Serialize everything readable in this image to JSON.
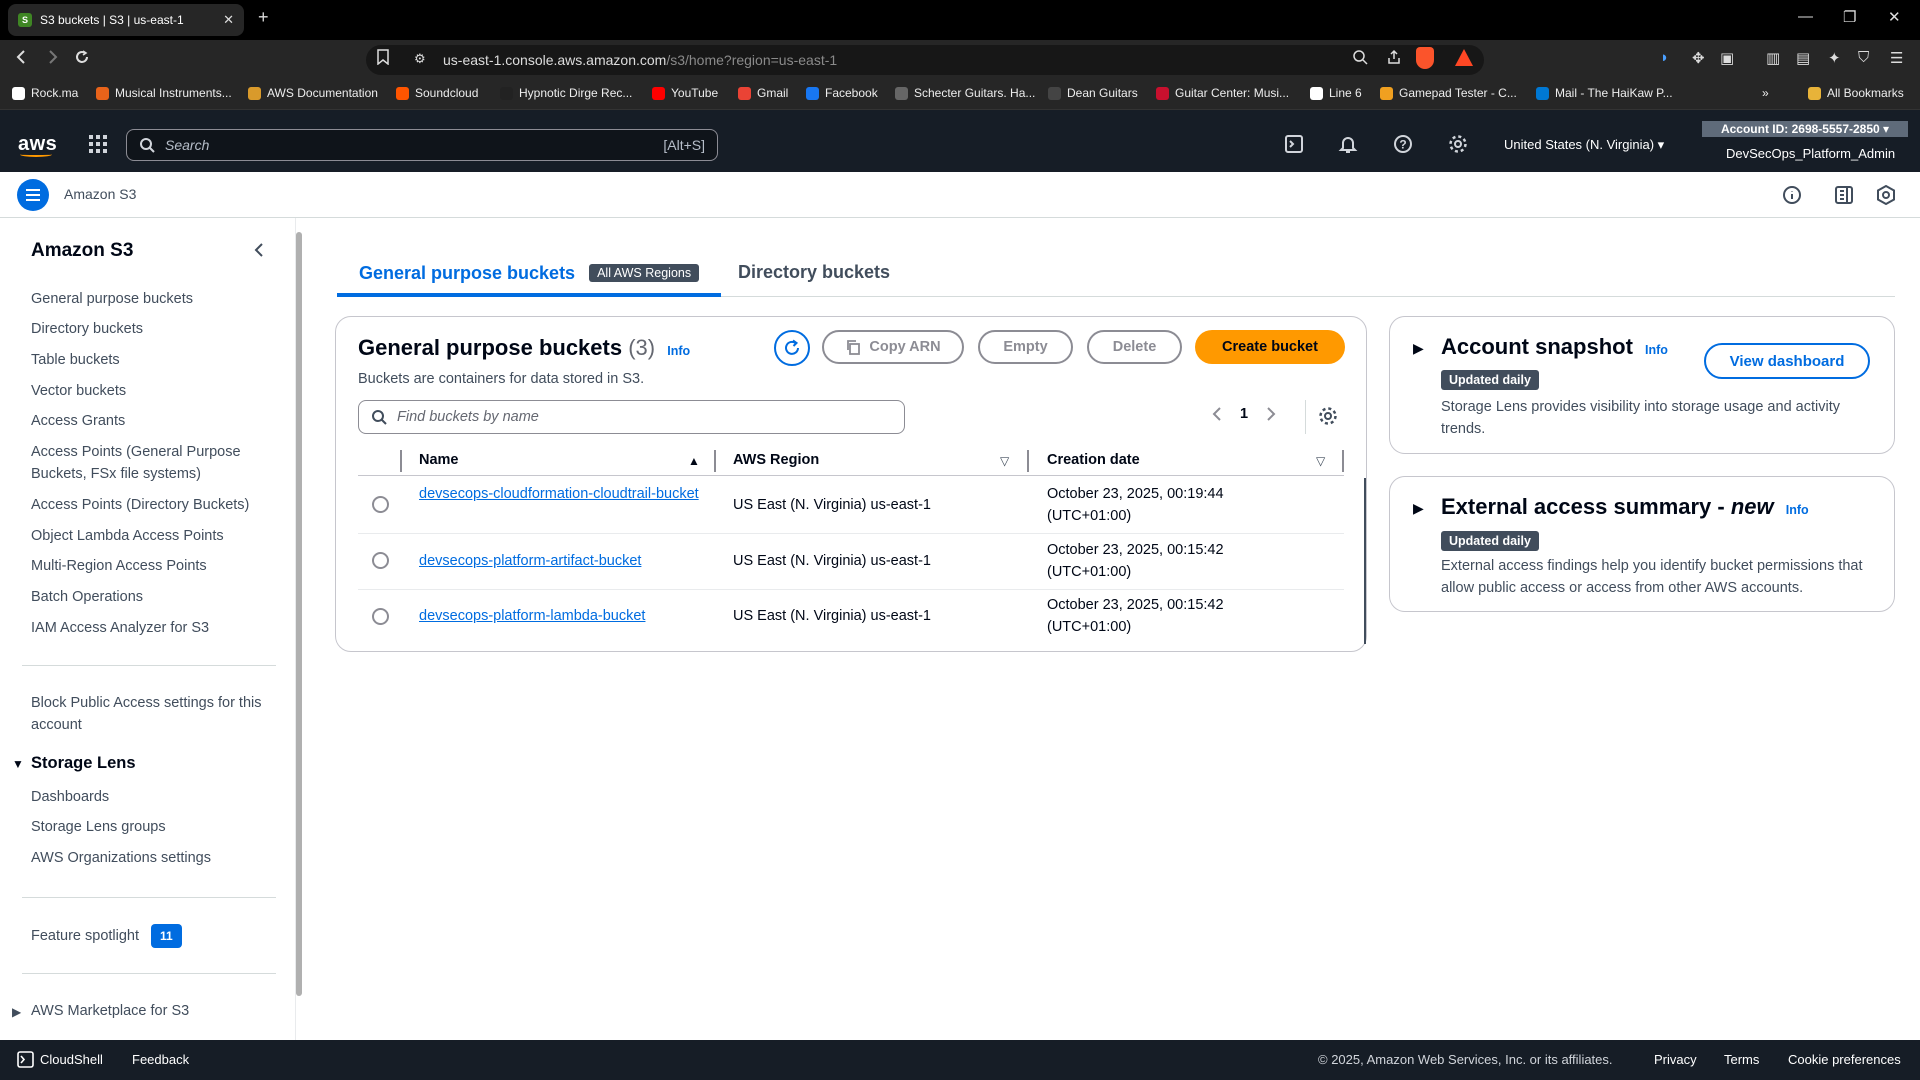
{
  "browser": {
    "tab_title": "S3 buckets | S3 | us-east-1",
    "url_host": "us-east-1.console.aws.amazon.com",
    "url_path": "/s3/home?region=us-east-1",
    "bookmarks": [
      {
        "label": "Rock.ma",
        "color": "#ffffff"
      },
      {
        "label": "Musical Instruments...",
        "color": "#e8631a"
      },
      {
        "label": "AWS Documentation",
        "color": "#d99a2b"
      },
      {
        "label": "Soundcloud",
        "color": "#ff5500"
      },
      {
        "label": "Hypnotic Dirge Rec...",
        "color": "#222222"
      },
      {
        "label": "YouTube",
        "color": "#ff0000"
      },
      {
        "label": "Gmail",
        "color": "#ea4335"
      },
      {
        "label": "Facebook",
        "color": "#1877f2"
      },
      {
        "label": "Schecter Guitars. Ha...",
        "color": "#666666"
      },
      {
        "label": "Dean Guitars",
        "color": "#444444"
      },
      {
        "label": "Guitar Center: Musi...",
        "color": "#c8102e"
      },
      {
        "label": "Line 6",
        "color": "#ffffff"
      },
      {
        "label": "Gamepad Tester - C...",
        "color": "#f0a020"
      },
      {
        "label": "Mail - The HaiKaw P...",
        "color": "#0078d4"
      }
    ],
    "all_bookmarks": "All Bookmarks"
  },
  "aws_header": {
    "logo": "aws",
    "search_placeholder": "Search",
    "search_shortcut": "[Alt+S]",
    "region": "United States (N. Virginia)",
    "account_id": "Account ID: 2698-5557-2850",
    "account_name": "DevSecOps_Platform_Admin"
  },
  "service_bar": {
    "name": "Amazon S3"
  },
  "sidebar": {
    "title": "Amazon S3",
    "items": [
      "General purpose buckets",
      "Directory buckets",
      "Table buckets",
      "Vector buckets",
      "Access Grants",
      "Access Points (General Purpose Buckets, FSx file systems)",
      "Access Points (Directory Buckets)",
      "Object Lambda Access Points",
      "Multi-Region Access Points",
      "Batch Operations",
      "IAM Access Analyzer for S3"
    ],
    "block_public_access": "Block Public Access settings for this account",
    "storage_lens": {
      "title": "Storage Lens",
      "items": [
        "Dashboards",
        "Storage Lens groups",
        "AWS Organizations settings"
      ]
    },
    "feature_spotlight": "Feature spotlight",
    "feature_spotlight_count": "11",
    "marketplace": "AWS Marketplace for S3"
  },
  "tabs": {
    "general": "General purpose buckets",
    "general_badge": "All AWS Regions",
    "directory": "Directory buckets"
  },
  "buckets_panel": {
    "title": "General purpose buckets",
    "count": "(3)",
    "info": "Info",
    "description": "Buckets are containers for data stored in S3.",
    "copy_arn": "Copy ARN",
    "empty": "Empty",
    "delete": "Delete",
    "create": "Create bucket",
    "find_placeholder": "Find buckets by name",
    "page": "1",
    "columns": [
      "Name",
      "AWS Region",
      "Creation date"
    ],
    "rows": [
      {
        "name": "devsecops-cloudformation-cloudtrail-bucket",
        "region": "US East (N. Virginia) us-east-1",
        "date": "October 23, 2025, 00:19:44 (UTC+01:00)"
      },
      {
        "name": "devsecops-platform-artifact-bucket",
        "region": "US East (N. Virginia) us-east-1",
        "date": "October 23, 2025, 00:15:42 (UTC+01:00)"
      },
      {
        "name": "devsecops-platform-lambda-bucket",
        "region": "US East (N. Virginia) us-east-1",
        "date": "October 23, 2025, 00:15:42 (UTC+01:00)"
      }
    ]
  },
  "snapshot": {
    "title": "Account snapshot",
    "info": "Info",
    "badge": "Updated daily",
    "text": "Storage Lens provides visibility into storage usage and activity trends.",
    "button": "View dashboard"
  },
  "external": {
    "title": "External access summary - ",
    "title_new": "new",
    "info": "Info",
    "badge": "Updated daily",
    "text": "External access findings help you identify bucket permissions that allow public access or access from other AWS accounts."
  },
  "footer": {
    "cloudshell": "CloudShell",
    "feedback": "Feedback",
    "copyright": "© 2025, Amazon Web Services, Inc. or its affiliates.",
    "privacy": "Privacy",
    "terms": "Terms",
    "cookies": "Cookie preferences"
  },
  "colors": {
    "accent": "#006ce0",
    "primary_button": "#ff9900",
    "header_bg": "#161d26"
  }
}
